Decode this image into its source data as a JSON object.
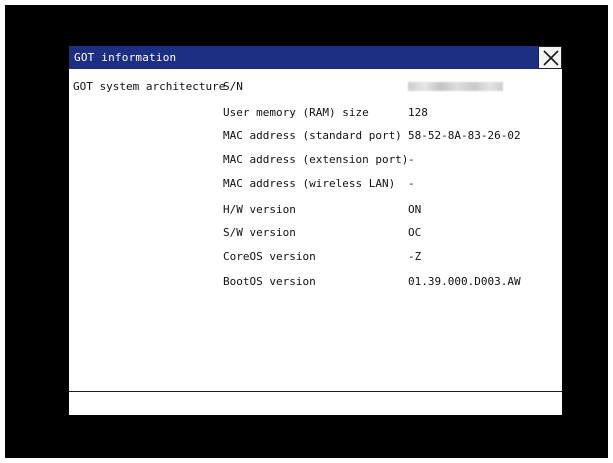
{
  "window": {
    "title": "GOT information"
  },
  "info": {
    "section_label": "GOT system architecture",
    "rows": [
      {
        "label": "S/N",
        "value": ""
      },
      {
        "label": "User memory (RAM) size",
        "value": "128"
      },
      {
        "label": "MAC address (standard port)",
        "value": "58-52-8A-83-26-02"
      },
      {
        "label": "MAC address (extension port)",
        "value": "-"
      },
      {
        "label": "MAC address (wireless LAN)",
        "value": "-"
      },
      {
        "label": "H/W version",
        "value": "ON"
      },
      {
        "label": "S/W version",
        "value": "OC"
      },
      {
        "label": "CoreOS version",
        "value": "-Z"
      },
      {
        "label": "BootOS version",
        "value": "01.39.000.D003.AW"
      }
    ]
  },
  "status_bar": {
    "text": ""
  },
  "colors": {
    "title_bar": "#1d2f82",
    "background": "#000000",
    "window": "#ffffff"
  },
  "icons": {
    "close": "close-icon"
  }
}
